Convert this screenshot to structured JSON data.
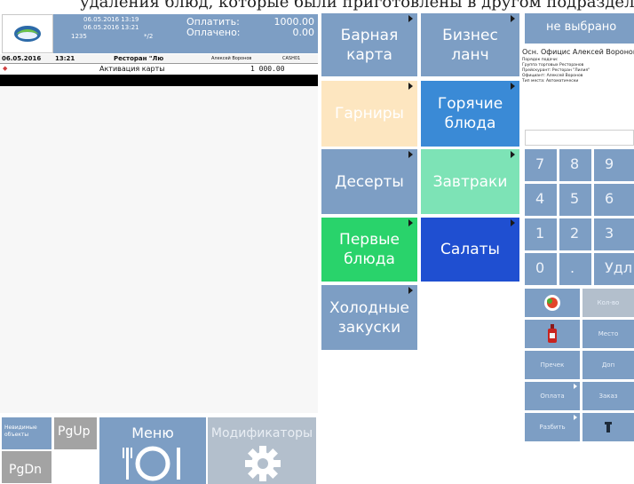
{
  "caption": "удаления блюд, которые были приготовлены в другом подразделении",
  "header": {
    "date_open": "06.05.2016 13:19",
    "date_now": "06.05.2016 13:21",
    "order_num": "1235",
    "table": "*/2",
    "to_pay_label": "Оплатить:",
    "to_pay_value": "1000.00",
    "paid_label": "Оплачено:",
    "paid_value": "0.00"
  },
  "order_row": {
    "date": "06.05.2016",
    "time": "13:21",
    "restaurant": "Ресторан \"Лю",
    "waiter": "Алексей Воронов",
    "cashier": "CASH01"
  },
  "order_line": {
    "name": "Активация карты",
    "amount": "1 000.00"
  },
  "categories": [
    {
      "label_1": "Барная",
      "label_2": "карта",
      "color": "#7d9ec4"
    },
    {
      "label_1": "Бизнес",
      "label_2": "ланч",
      "color": "#7d9ec4"
    },
    {
      "label_1": "Гарниры",
      "label_2": "",
      "color": "#fde6c0"
    },
    {
      "label_1": "Горячие",
      "label_2": "блюда",
      "color": "#3a8ad6"
    },
    {
      "label_1": "Десерты",
      "label_2": "",
      "color": "#7d9ec4"
    },
    {
      "label_1": "Завтраки",
      "label_2": "",
      "color": "#7de3b6"
    },
    {
      "label_1": "Первые",
      "label_2": "блюда",
      "color": "#29d36b"
    },
    {
      "label_1": "Салаты",
      "label_2": "",
      "color": "#1f4fd1"
    },
    {
      "label_1": "Холодные",
      "label_2": "закуски",
      "color": "#7d9ec4"
    }
  ],
  "right_panel": {
    "not_selected": "не выбрано",
    "waiter_line": "Осн. Официс   Алексей Воронов",
    "info_lines": [
      "Порядок подачи:",
      "Группа торговых Ресторанов",
      "Прейскурант: Ресторан \"Лилия\"",
      "Официант: Алексей Воронов",
      "Тип места: Автоматически"
    ]
  },
  "keypad": [
    "7",
    "8",
    "9",
    "4",
    "5",
    "6",
    "1",
    "2",
    "3",
    "0",
    ".",
    "Удл"
  ],
  "actions": {
    "qty": "Кол-во",
    "place": "Место",
    "prechek": "Пречек",
    "dop": "Доп",
    "payment": "Оплата",
    "order": "Заказ",
    "split": "Разбить"
  },
  "bottom": {
    "invisible_objects": "Невидимые объекты",
    "pgup": "PgUp",
    "pgdn": "PgDn",
    "menu": "Меню",
    "modifiers": "Модификаторы"
  }
}
